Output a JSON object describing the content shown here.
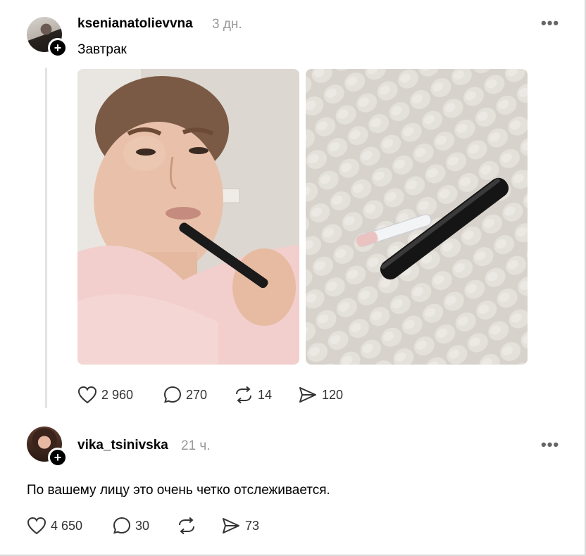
{
  "posts": [
    {
      "username": "ksenianatolievvna",
      "time": "3 дн.",
      "text": "Завтрак",
      "more_icon": "more-horizontal-icon",
      "stats": {
        "likes": "2 960",
        "comments": "270",
        "reposts": "14",
        "shares": "120"
      }
    },
    {
      "username": "vika_tsinivska",
      "time": "21 ч.",
      "text": "По вашему лицу это очень четко отслеживается.",
      "more_icon": "more-horizontal-icon",
      "stats": {
        "likes": "4 650",
        "comments": "30",
        "reposts": "",
        "shares": "73"
      }
    }
  ],
  "icons": {
    "like": "heart-icon",
    "comment": "comment-icon",
    "repost": "repost-icon",
    "share": "send-icon",
    "follow": "plus-icon"
  },
  "colors": {
    "text": "#000000",
    "muted": "#999999",
    "icon": "#333333",
    "thread_line": "#e3e3e3"
  }
}
